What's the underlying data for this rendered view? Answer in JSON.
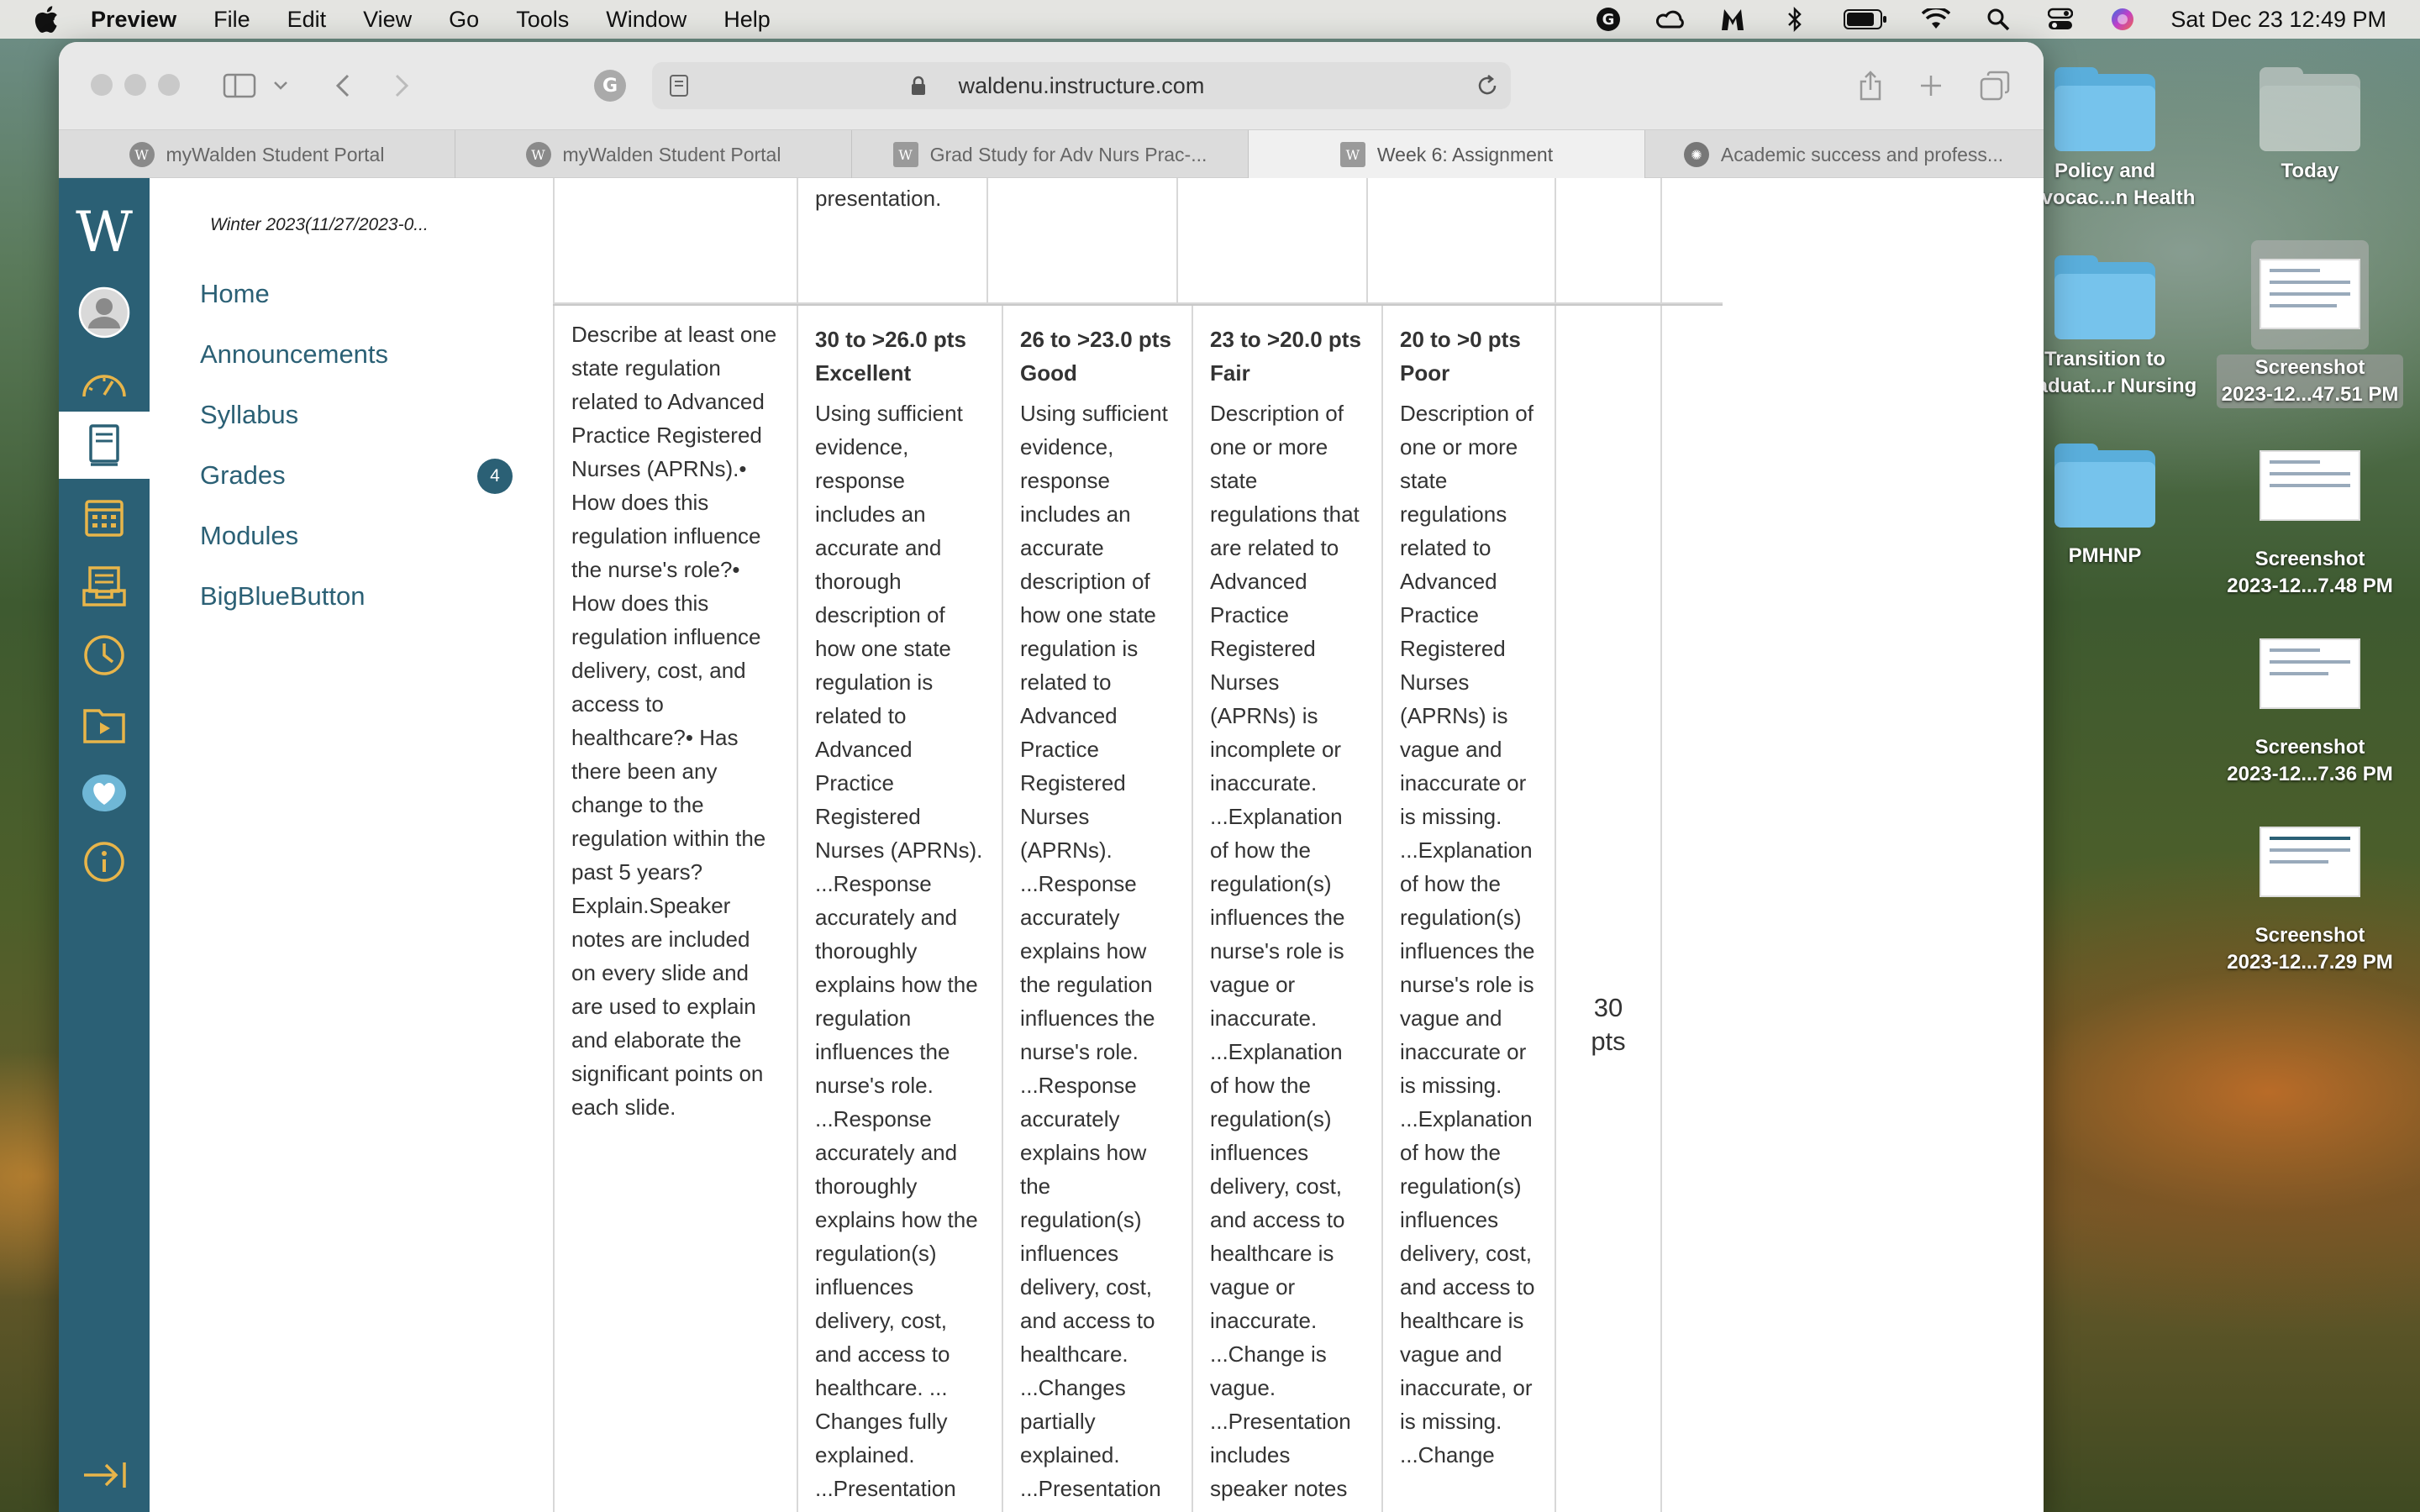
{
  "menubar": {
    "app": "Preview",
    "items": [
      "File",
      "Edit",
      "View",
      "Go",
      "Tools",
      "Window",
      "Help"
    ],
    "clock": "Sat Dec 23  12:49 PM"
  },
  "browser": {
    "url": "waldenu.instructure.com",
    "tabs": [
      {
        "title": "myWalden Student Portal",
        "icon": "walden-favicon"
      },
      {
        "title": "myWalden Student Portal",
        "icon": "walden-favicon"
      },
      {
        "title": "Grad Study for Adv Nurs Prac-...",
        "icon": "canvas-favicon"
      },
      {
        "title": "Week 6: Assignment",
        "icon": "canvas-favicon"
      },
      {
        "title": "Academic success and profess...",
        "icon": "gear-favicon"
      }
    ],
    "active_tab": 3
  },
  "rail": {
    "logo": "W",
    "active": "courses"
  },
  "coursenav": {
    "term": "Winter 2023(11/27/2023-0...",
    "links": [
      "Home",
      "Announcements",
      "Syllabus",
      "Grades",
      "Modules",
      "BigBlueButton"
    ],
    "grades_badge": "4"
  },
  "rubric": {
    "prev_row_text": "presentation.",
    "criterion": "Describe at least one state regulation related to Advanced Practice Registered Nurses (APRNs).• How does this regulation influence the nurse's role?• How does this regulation influence delivery, cost, and access to healthcare?• Has there been any change to the regulation within the past 5 years? Explain.Speaker notes are included on every slide and are used to explain and elaborate the significant points on each slide.",
    "ratings": [
      {
        "points": "30 to >26.0 pts",
        "label": "Excellent",
        "desc": "Using sufficient evidence, response includes an accurate and thorough description of how one state regulation is related to Advanced Practice Registered Nurses (APRNs). ...Response accurately and thoroughly explains how the regulation influences the nurse's role. ...Response accurately and thoroughly explains how the regulation(s) influences delivery, cost, and access to healthcare. ... Changes fully explained. ...Presentation includes speaker notes that"
      },
      {
        "points": "26 to >23.0 pts",
        "label": "Good",
        "desc": "Using sufficient evidence, response includes an accurate description of how one state regulation is related to Advanced Practice Registered Nurses (APRNs). ...Response accurately explains how the regulation influences the nurse's role. ...Response accurately explains how the regulation(s) influences delivery, cost, and access to healthcare. ...Changes partially explained. ...Presentation includes speaker notes"
      },
      {
        "points": "23 to >20.0 pts",
        "label": "Fair",
        "desc": "Description of one or more state regulations that are related to Advanced Practice Registered Nurses (APRNs) is incomplete or inaccurate. ...Explanation of how the regulation(s) influences the nurse's role is vague or inaccurate. ...Explanation of how the regulation(s) influences delivery, cost, and access to healthcare is vague or inaccurate. ...Change is vague. ...Presentation includes speaker notes that are incomplete"
      },
      {
        "points": "20 to >0 pts",
        "label": "Poor",
        "desc": "Description of one or more state regulations related to Advanced Practice Registered Nurses (APRNs) is vague and inaccurate or is missing. ...Explanation of how the regulation(s) influences the nurse's role is vague and inaccurate or is missing. ...Explanation of how the regulation(s) influences delivery, cost, and access to healthcare is vague and inaccurate, or is missing. ...Change"
      }
    ],
    "total": "30 pts"
  },
  "desktop": {
    "icons": [
      {
        "label": "Policy and\nAdvocac...n Health",
        "kind": "folder"
      },
      {
        "label": "Today",
        "kind": "folder-light"
      },
      {
        "label": "Transition to\nGraduat...r Nursing",
        "kind": "folder"
      },
      {
        "label": "Screenshot\n2023-12...47.51 PM",
        "kind": "screenshot"
      },
      {
        "label": "PMHNP",
        "kind": "folder"
      },
      {
        "label": "Screenshot\n2023-12...7.48 PM",
        "kind": "screenshot"
      },
      {
        "label": "Screenshot\n2023-12...7.36 PM",
        "kind": "screenshot"
      },
      {
        "label": "Screenshot\n2023-12...7.29 PM",
        "kind": "screenshot"
      }
    ]
  }
}
